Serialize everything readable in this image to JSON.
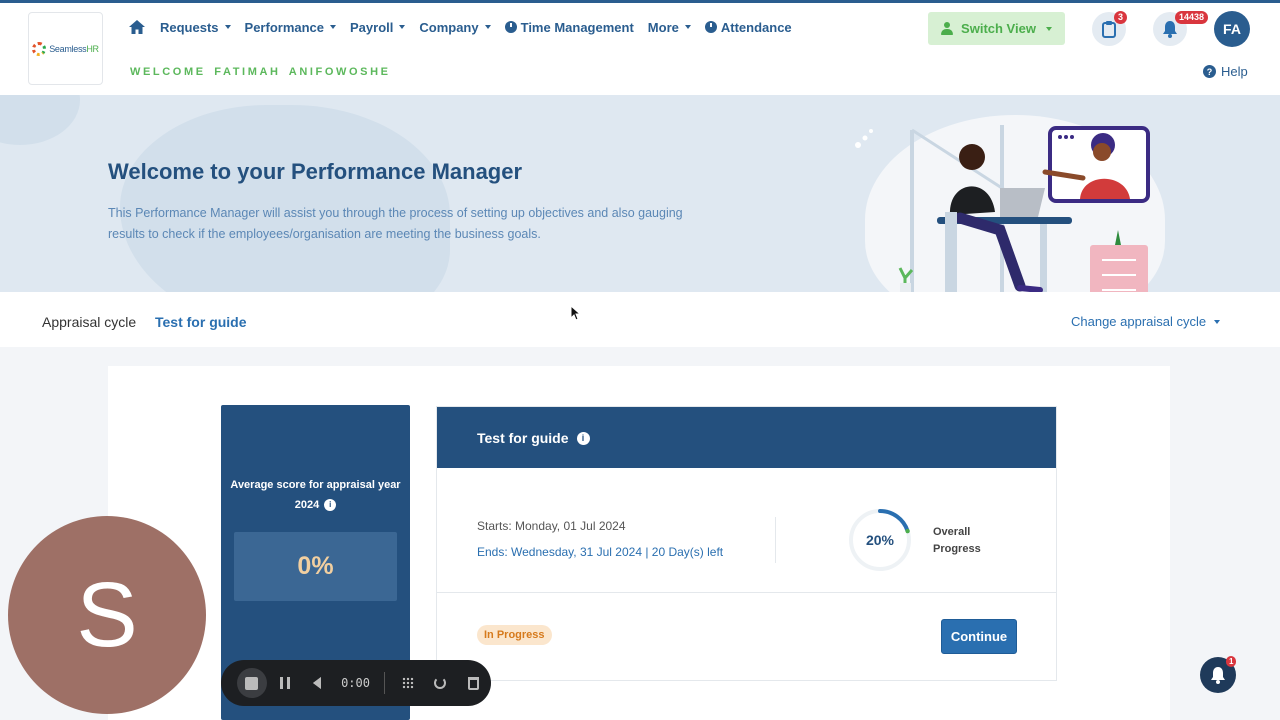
{
  "brand": {
    "logo_text_a": "Seamless",
    "logo_text_b": "HR"
  },
  "nav": {
    "items": [
      {
        "label": "Requests",
        "dropdown": true
      },
      {
        "label": "Performance",
        "dropdown": true
      },
      {
        "label": "Payroll",
        "dropdown": true
      },
      {
        "label": "Company",
        "dropdown": true
      },
      {
        "label": "Time Management",
        "icon": "clock-icon"
      },
      {
        "label": "More",
        "dropdown": true
      },
      {
        "label": "Attendance",
        "icon": "clock-icon"
      }
    ]
  },
  "header": {
    "welcome": "WELCOME FATIMAH ANIFOWOSHE",
    "switch_view": "Switch View",
    "tasks_badge": "3",
    "notifications_badge": "14438",
    "avatar_initials": "FA",
    "help": "Help"
  },
  "banner": {
    "title": "Welcome to your Performance Manager",
    "description": "This Performance Manager will assist you through the process of setting up objectives and also gauging results to check if the employees/organisation are meeting the business goals."
  },
  "cycle": {
    "label": "Appraisal cycle",
    "value": "Test for guide",
    "change": "Change appraisal cycle"
  },
  "score": {
    "label": "Average score for appraisal year 2024",
    "value": "0%"
  },
  "appraisal": {
    "title": "Test for guide",
    "starts": "Starts: Monday, 01 Jul 2024",
    "ends": "Ends: Wednesday, 31 Jul 2024 | 20 Day(s) left",
    "progress_text": "20%",
    "progress_fraction": 0.2,
    "overall_label": "Overall Progress",
    "status": "In Progress",
    "continue": "Continue"
  },
  "overlay": {
    "camera_initial": "S",
    "recorder_time": "0:00",
    "float_bell_badge": "1"
  },
  "colors": {
    "primary": "#24507e",
    "accent": "#2a6fb0",
    "green": "#4cae4c",
    "badge_red": "#d9363e",
    "progress_arc": "#2a6fb0",
    "progress_tip": "#4cae4c"
  }
}
